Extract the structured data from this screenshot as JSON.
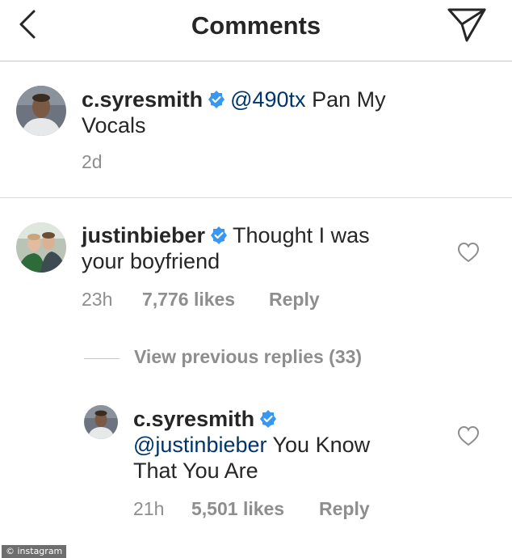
{
  "header": {
    "title": "Comments",
    "back_icon": "chevron-left-icon",
    "send_icon": "paper-plane-icon"
  },
  "caption": {
    "username": "c.syresmith",
    "mention": "@490tx",
    "text": " Pan My",
    "text_line2": "Vocals",
    "time": "2d"
  },
  "comment": {
    "username": "justinbieber",
    "text": "Thought I was",
    "text_line2": "your boyfriend",
    "time": "23h",
    "likes": "7,776 likes",
    "reply": "Reply"
  },
  "view_previous": "View previous replies (33)",
  "reply": {
    "username": "c.syresmith",
    "mention": "@justinbieber",
    "text": " You Know",
    "text_line2": "That You Are",
    "time": "21h",
    "likes": "5,501 likes",
    "reply": "Reply"
  },
  "watermark": "© instagram",
  "colors": {
    "verified": "#3897f0",
    "mention": "#003569",
    "meta": "#8e8e8e",
    "text": "#262626"
  }
}
